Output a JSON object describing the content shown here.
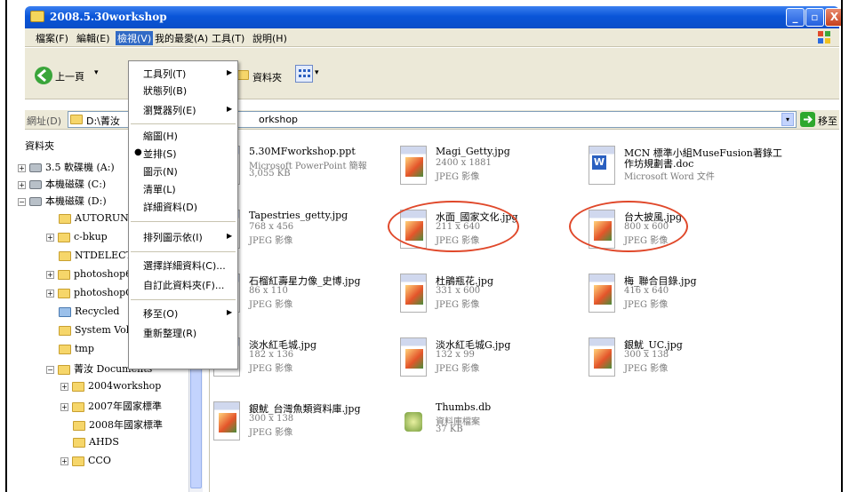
{
  "window": {
    "title": "2008.5.30workshop"
  },
  "menubar": [
    "檔案(F)",
    "編輯(E)",
    "檢視(V)",
    "我的最愛(A)",
    "工具(T)",
    "說明(H)"
  ],
  "toolbar": {
    "back_label": "上一頁",
    "folders_label": "資料夾"
  },
  "address": {
    "label": "網址(D)",
    "path": "D:\\菁汝",
    "path_end": "orkshop",
    "go_label": "移至"
  },
  "sidebar": {
    "title": "資料夾",
    "items": [
      {
        "label": "3.5 軟碟機 (A:)"
      },
      {
        "label": "本機磁碟 (C:)"
      },
      {
        "label": "本機磁碟 (D:)"
      },
      {
        "label": "AUTORUN.I"
      },
      {
        "label": "c-bkup"
      },
      {
        "label": "NTDELECT"
      },
      {
        "label": "photoshop6.("
      },
      {
        "label": "photoshopCS"
      },
      {
        "label": "Recycled"
      },
      {
        "label": "System Volu"
      },
      {
        "label": "tmp"
      },
      {
        "label": "菁汝 Documents"
      },
      {
        "label": "2004workshop"
      },
      {
        "label": "2007年國家標準"
      },
      {
        "label": "2008年國家標準"
      },
      {
        "label": "AHDS"
      },
      {
        "label": "CCO"
      }
    ]
  },
  "view_menu": {
    "items": [
      "工具列(T)",
      "狀態列(B)",
      "瀏覽器列(E)",
      "縮圖(H)",
      "並排(S)",
      "圖示(N)",
      "清單(L)",
      "詳細資料(D)",
      "排列圖示依(I)",
      "選擇詳細資料(C)...",
      "自訂此資料夾(F)...",
      "移至(O)",
      "重新整理(R)"
    ]
  },
  "files": [
    {
      "name": "5.30MFworkshop.ppt",
      "line2": "Microsoft PowerPoint 簡報",
      "line3": "3,055 KB",
      "icon": "ppt-icon"
    },
    {
      "name": "Magi_Getty.jpg",
      "line2": "2400 x 1881",
      "line3": "JPEG 影像",
      "icon": "jpeg-icon"
    },
    {
      "name": "MCN 標準小組MuseFusion著錄工",
      "line2": "作坊規劃書.doc",
      "line3": "Microsoft Word 文件",
      "icon": "word-icon"
    },
    {
      "name": "Tapestries_getty.jpg",
      "line2": "768 x 456",
      "line3": "JPEG 影像",
      "icon": "jpeg-icon"
    },
    {
      "name": "水面_國家文化.jpg",
      "line2": "211 x 640",
      "line3": "JPEG 影像",
      "icon": "jpeg-icon"
    },
    {
      "name": "台大披風.jpg",
      "line2": "800 x 600",
      "line3": "JPEG 影像",
      "icon": "jpeg-icon"
    },
    {
      "name": "石榴紅壽星力像_史博.jpg",
      "line2": "86 x 110",
      "line3": "JPEG 影像",
      "icon": "jpeg-icon"
    },
    {
      "name": "杜鵑瓶花.jpg",
      "line2": "331 x 600",
      "line3": "JPEG 影像",
      "icon": "jpeg-icon"
    },
    {
      "name": "梅_聯合目錄.jpg",
      "line2": "416 x 640",
      "line3": "JPEG 影像",
      "icon": "jpeg-icon"
    },
    {
      "name": "淡水紅毛城.jpg",
      "line2": "182 x 136",
      "line3": "JPEG 影像",
      "icon": "jpeg-icon"
    },
    {
      "name": "淡水紅毛城G.jpg",
      "line2": "132 x 99",
      "line3": "JPEG 影像",
      "icon": "jpeg-icon"
    },
    {
      "name": "銀魷_UC.jpg",
      "line2": "300 x 138",
      "line3": "JPEG 影像",
      "icon": "jpeg-icon"
    },
    {
      "name": "銀魷_台灣魚類資料庫.jpg",
      "line2": "300 x 138",
      "line3": "JPEG 影像",
      "icon": "jpeg-icon"
    },
    {
      "name": "Thumbs.db",
      "line2": "資料庫檔案",
      "line3": "37 KB",
      "icon": "database-icon"
    }
  ],
  "colors": {
    "titlebar": "#0a55d8",
    "highlight_ring": "#e0482a",
    "menu_highlight": "#316ac5"
  }
}
